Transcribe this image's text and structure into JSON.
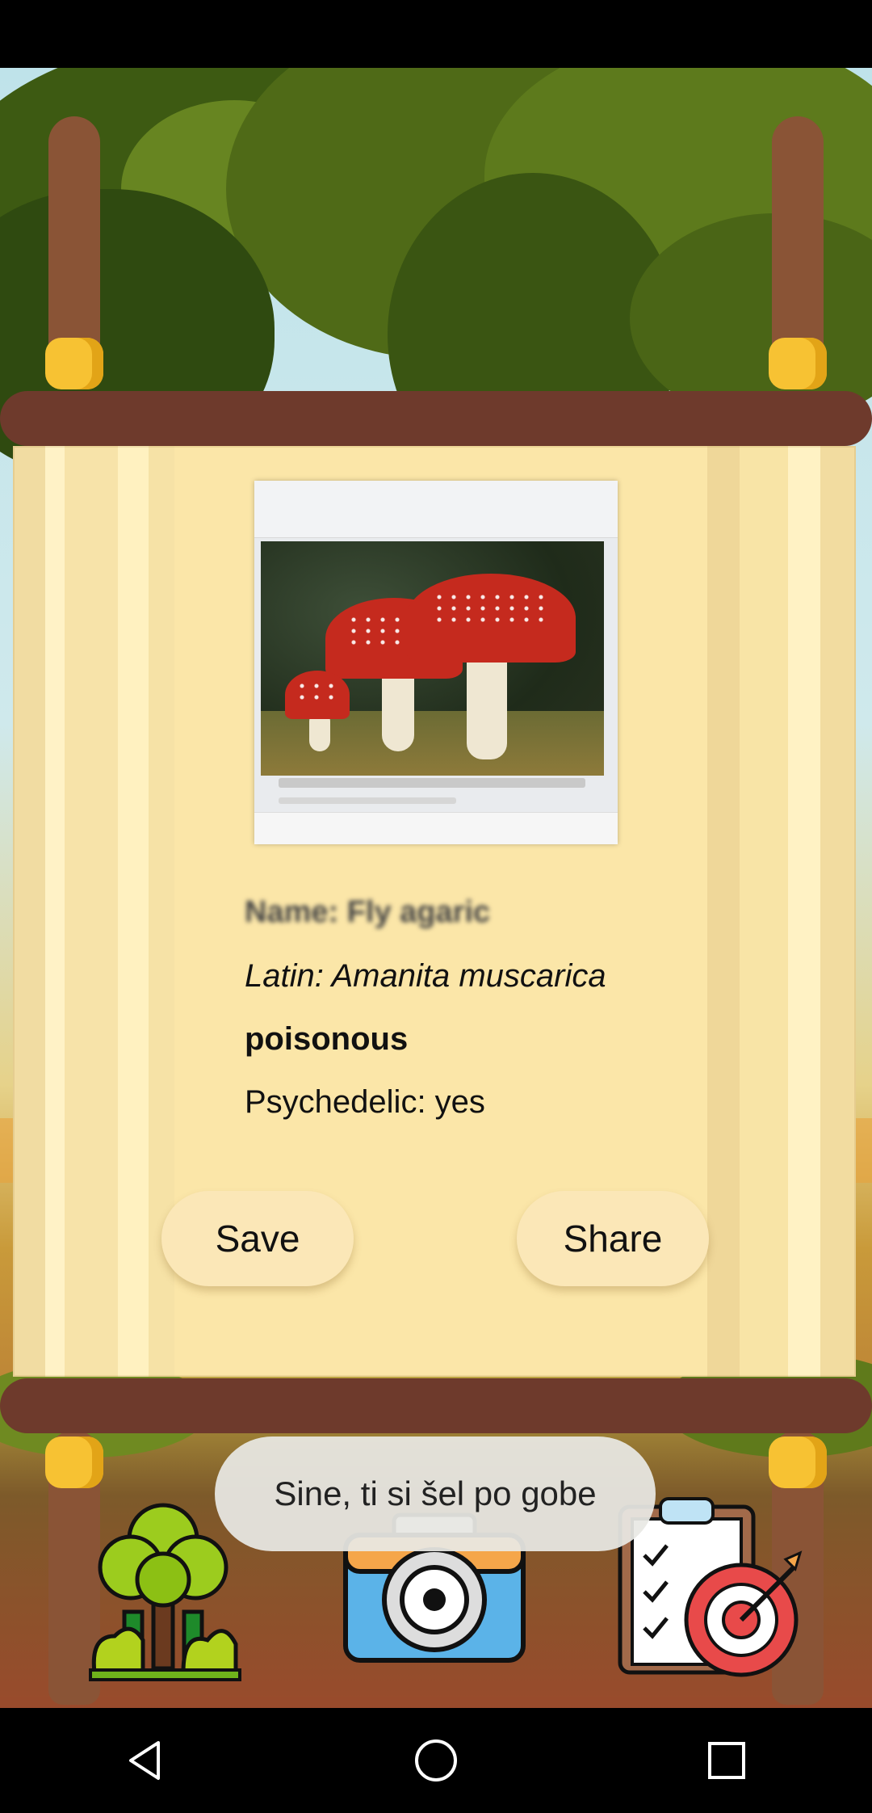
{
  "mushroom": {
    "name_text": "Name: Fly agaric",
    "latin_text": "Latin: Amanita muscarica",
    "toxicity_text": "poisonous",
    "psychedelic_text": "Psychedelic: yes"
  },
  "actions": {
    "save_label": "Save",
    "share_label": "Share"
  },
  "toast": {
    "message": "Sine, ti si šel po gobe"
  },
  "bottom_nav": {
    "items": [
      {
        "icon": "forest-tree-icon"
      },
      {
        "icon": "camera-icon"
      },
      {
        "icon": "checklist-target-icon"
      }
    ]
  },
  "system_nav": {
    "icons": [
      "back-icon",
      "home-icon",
      "recents-icon"
    ]
  },
  "colors": {
    "scroll_paper": "#fbe6a8",
    "button_bg": "#fbe7b7",
    "rod": "#6e3a2c",
    "ring": "#f7c233"
  }
}
